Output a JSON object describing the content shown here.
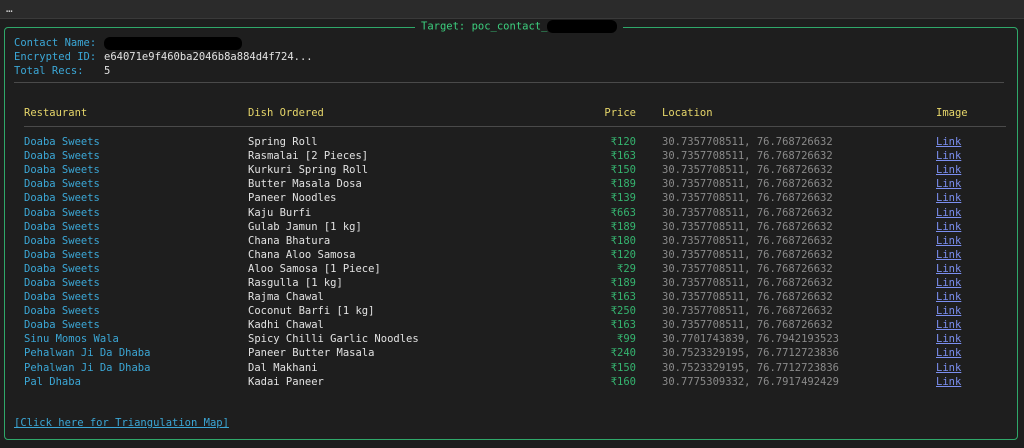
{
  "window": {
    "ellipsis": "…"
  },
  "panel": {
    "title": "Target: poc_contact_"
  },
  "meta": {
    "contact_name_label": "Contact Name:",
    "encrypted_id_label": "Encrypted ID:",
    "encrypted_id_value": "e64071e9f460ba2046b8a884d4f724...",
    "total_recs_label": "Total Recs:",
    "total_recs_value": "5"
  },
  "table": {
    "headers": {
      "restaurant": "Restaurant",
      "dish": "Dish Ordered",
      "price": "Price",
      "location": "Location",
      "image": "Image"
    },
    "rows": [
      {
        "restaurant": "Doaba Sweets",
        "dish": "Spring Roll",
        "price": "₹120",
        "location": "30.7357708511, 76.768726632",
        "image": "Link"
      },
      {
        "restaurant": "Doaba Sweets",
        "dish": "Rasmalai [2 Pieces]",
        "price": "₹163",
        "location": "30.7357708511, 76.768726632",
        "image": "Link"
      },
      {
        "restaurant": "Doaba Sweets",
        "dish": "Kurkuri Spring Roll",
        "price": "₹150",
        "location": "30.7357708511, 76.768726632",
        "image": "Link"
      },
      {
        "restaurant": "Doaba Sweets",
        "dish": "Butter Masala Dosa",
        "price": "₹189",
        "location": "30.7357708511, 76.768726632",
        "image": "Link"
      },
      {
        "restaurant": "Doaba Sweets",
        "dish": "Paneer Noodles",
        "price": "₹139",
        "location": "30.7357708511, 76.768726632",
        "image": "Link"
      },
      {
        "restaurant": "Doaba Sweets",
        "dish": "Kaju Burfi",
        "price": "₹663",
        "location": "30.7357708511, 76.768726632",
        "image": "Link"
      },
      {
        "restaurant": "Doaba Sweets",
        "dish": "Gulab Jamun [1 kg]",
        "price": "₹189",
        "location": "30.7357708511, 76.768726632",
        "image": "Link"
      },
      {
        "restaurant": "Doaba Sweets",
        "dish": "Chana Bhatura",
        "price": "₹180",
        "location": "30.7357708511, 76.768726632",
        "image": "Link"
      },
      {
        "restaurant": "Doaba Sweets",
        "dish": "Chana Aloo Samosa",
        "price": "₹120",
        "location": "30.7357708511, 76.768726632",
        "image": "Link"
      },
      {
        "restaurant": "Doaba Sweets",
        "dish": "Aloo Samosa [1 Piece]",
        "price": "₹29",
        "location": "30.7357708511, 76.768726632",
        "image": "Link"
      },
      {
        "restaurant": "Doaba Sweets",
        "dish": "Rasgulla [1 kg]",
        "price": "₹189",
        "location": "30.7357708511, 76.768726632",
        "image": "Link"
      },
      {
        "restaurant": "Doaba Sweets",
        "dish": "Rajma Chawal",
        "price": "₹163",
        "location": "30.7357708511, 76.768726632",
        "image": "Link"
      },
      {
        "restaurant": "Doaba Sweets",
        "dish": "Coconut Barfi [1 kg]",
        "price": "₹250",
        "location": "30.7357708511, 76.768726632",
        "image": "Link"
      },
      {
        "restaurant": "Doaba Sweets",
        "dish": "Kadhi Chawal",
        "price": "₹163",
        "location": "30.7357708511, 76.768726632",
        "image": "Link"
      },
      {
        "restaurant": "Sinu Momos Wala",
        "dish": "Spicy Chilli Garlic Noodles",
        "price": "₹99",
        "location": "30.7701743839, 76.7942193523",
        "image": "Link"
      },
      {
        "restaurant": "Pehalwan Ji Da Dhaba",
        "dish": "Paneer Butter Masala",
        "price": "₹240",
        "location": "30.7523329195, 76.7712723836",
        "image": "Link"
      },
      {
        "restaurant": "Pehalwan Ji Da Dhaba",
        "dish": "Dal Makhani",
        "price": "₹150",
        "location": "30.7523329195, 76.7712723836",
        "image": "Link"
      },
      {
        "restaurant": "Pal Dhaba",
        "dish": "Kadai Paneer",
        "price": "₹160",
        "location": "30.7775309332, 76.7917492429",
        "image": "Link"
      }
    ]
  },
  "footer": {
    "map_link": "[Click here for Triangulation Map]"
  },
  "colors": {
    "border": "#2fa86a",
    "title": "#3ccf7e",
    "key": "#3ba7d6",
    "header": "#e6d66a",
    "price": "#35b36f",
    "link": "#7b8ff0"
  }
}
